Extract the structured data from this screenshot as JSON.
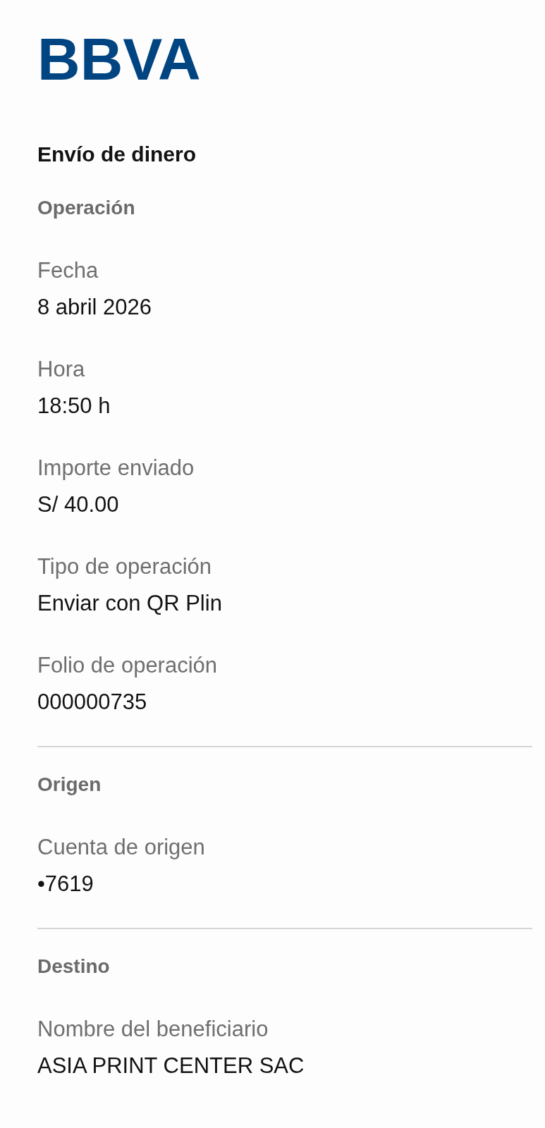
{
  "logo": {
    "text": "BBVA"
  },
  "title": "Envío de dinero",
  "sections": [
    {
      "heading": "Operación",
      "fields": [
        {
          "label": "Fecha",
          "value": "8 abril 2026"
        },
        {
          "label": "Hora",
          "value": "18:50 h"
        },
        {
          "label": "Importe enviado",
          "value": "S/ 40.00"
        },
        {
          "label": "Tipo de operación",
          "value": "Enviar con QR Plin"
        },
        {
          "label": "Folio de operación",
          "value": "000000735"
        }
      ]
    },
    {
      "heading": "Origen",
      "fields": [
        {
          "label": "Cuenta de origen",
          "value": "•7619"
        }
      ]
    },
    {
      "heading": "Destino",
      "fields": [
        {
          "label": "Nombre del beneficiario",
          "value": "ASIA PRINT CENTER SAC"
        }
      ]
    }
  ]
}
